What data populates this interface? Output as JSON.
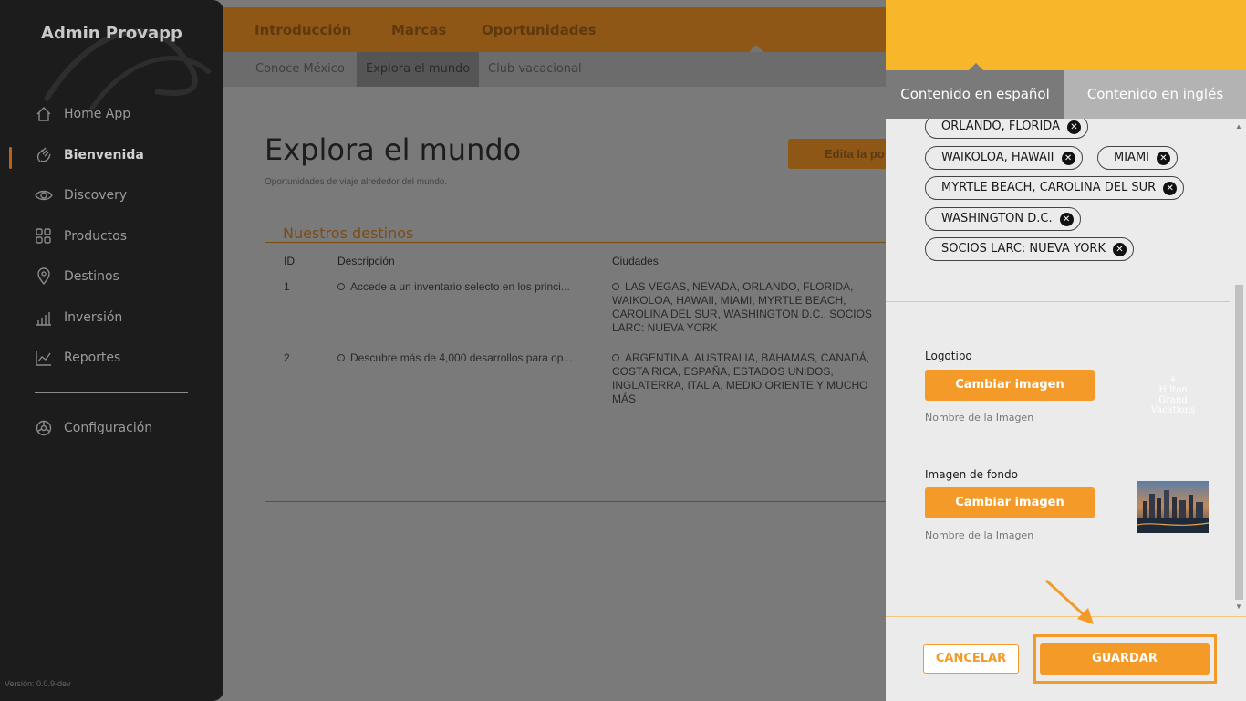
{
  "sidebar": {
    "brand": "Admin Provapp",
    "items": [
      {
        "label": "Home App",
        "icon": "home-icon"
      },
      {
        "label": "Bienvenida",
        "icon": "waving-hand-icon"
      },
      {
        "label": "Discovery",
        "icon": "eye-icon"
      },
      {
        "label": "Productos",
        "icon": "grid-icon"
      },
      {
        "label": "Destinos",
        "icon": "map-pin-icon"
      },
      {
        "label": "Inversión",
        "icon": "bar-chart-icon"
      },
      {
        "label": "Reportes",
        "icon": "line-chart-icon"
      }
    ],
    "active_item": "Bienvenida",
    "config": {
      "label": "Configuración",
      "icon": "settings-icon"
    },
    "version": "Versión: 0.0.9-dev"
  },
  "topnav": {
    "tabs": [
      "Introducción",
      "Marcas",
      "Oportunidades"
    ],
    "active": "Oportunidades"
  },
  "subnav": {
    "tabs": [
      "Conoce México",
      "Explora el mundo",
      "Club vacacional"
    ],
    "active": "Explora el mundo"
  },
  "page": {
    "title": "Explora el mundo",
    "subtitle": "Oportunidades de viaje alrededor del mundo.",
    "edit_button": "Edita la po",
    "section_title": "Nuestros destinos"
  },
  "table": {
    "headers": [
      "ID",
      "Descripción",
      "Ciudades"
    ],
    "rows": [
      {
        "id": "1",
        "description": "Accede a un inventario selecto en los princi...",
        "cities": "LAS VEGAS, NEVADA, ORLANDO, FLORIDA, WAIKOLOA, HAWAII, MIAMI, MYRTLE BEACH, CAROLINA DEL SUR, WASHINGTON D.C., SOCIOS LARC: NUEVA YORK"
      },
      {
        "id": "2",
        "description": "Descubre más de 4,000 desarrollos para op...",
        "cities": "ARGENTINA, AUSTRALIA, BAHAMAS, CANADÁ, COSTA RICA, ESPAÑA, ESTADOS UNIDOS, INGLATERRA, ITALIA, MEDIO ORIENTE Y MUCHO MÁS"
      }
    ]
  },
  "panel": {
    "tabs": {
      "spanish": "Contenido en español",
      "english": "Contenido en inglés"
    },
    "chips": [
      "ORLANDO, FLORIDA",
      "WAIKOLOA, HAWAII",
      "MIAMI",
      "MYRTLE BEACH, CAROLINA DEL SUR",
      "WASHINGTON D.C.",
      "SOCIOS LARC: NUEVA YORK"
    ],
    "logo": {
      "label": "Logotipo",
      "button": "Cambiar imagen",
      "filename": "Nombre de la Imagen",
      "preview_line1": "Hilton",
      "preview_line2": "Grand Vacations"
    },
    "background": {
      "label": "Imagen de fondo",
      "button": "Cambiar imagen",
      "filename": "Nombre de la Imagen"
    },
    "cancel_button": "CANCELAR",
    "save_button": "GUARDAR"
  },
  "colors": {
    "accent": "#f39a28",
    "header_yellow": "#f8b62a",
    "sidebar_bg": "#1c1c1c"
  }
}
